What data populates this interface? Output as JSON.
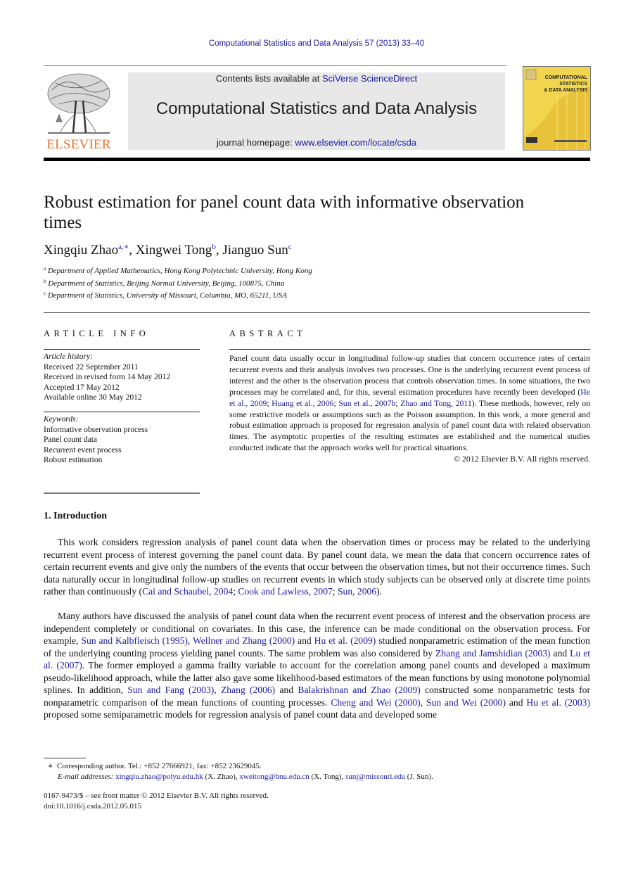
{
  "running_head": "Computational Statistics and Data Analysis 57 (2013) 33–40",
  "masthead": {
    "publisher": "ELSEVIER",
    "contents_prefix": "Contents lists available at ",
    "contents_link": "SciVerse ScienceDirect",
    "journal_title": "Computational Statistics and Data Analysis",
    "homepage_prefix": "journal homepage: ",
    "homepage_link": "www.elsevier.com/locate/csda",
    "cover_lines": [
      "COMPUTATIONAL",
      "STATISTICS",
      "& DATA ANALYSIS"
    ],
    "colors": {
      "publisher_orange": "#e8732c",
      "cover_yellow": "#f2d54e",
      "link_blue": "#1a1aa6"
    }
  },
  "article": {
    "title": "Robust estimation for panel count data with informative observation times",
    "authors": [
      {
        "name": "Xingqiu Zhao",
        "marks": "a,∗",
        "sep": ", "
      },
      {
        "name": "Xingwei Tong",
        "marks": "b",
        "sep": ", "
      },
      {
        "name": "Jianguo Sun",
        "marks": "c",
        "sep": ""
      }
    ],
    "affiliations": [
      {
        "mark": "a",
        "text": "Department of Applied Mathematics, Hong Kong Polytechnic University, Hong Kong"
      },
      {
        "mark": "b",
        "text": "Department of Statistics, Beijing Normal University, Beijing, 100875, China"
      },
      {
        "mark": "c",
        "text": "Department of Statistics, University of Missouri, Columbia, MO, 65211, USA"
      }
    ]
  },
  "article_info": {
    "heading": "ARTICLE INFO",
    "history_label": "Article history:",
    "history": [
      "Received 22 September 2011",
      "Received in revised form 14 May 2012",
      "Accepted 17 May 2012",
      "Available online 30 May 2012"
    ],
    "keywords_label": "Keywords:",
    "keywords": [
      "Informative observation process",
      "Panel count data",
      "Recurrent event process",
      "Robust estimation"
    ]
  },
  "abstract": {
    "heading": "ABSTRACT",
    "text_1": "Panel count data usually occur in longitudinal follow-up studies that concern occurrence rates of certain recurrent events and their analysis involves two processes. One is the underlying recurrent event process of interest and the other is the observation process that controls observation times. In some situations, the two processes may be correlated and, for this, several estimation procedures have recently been developed (",
    "cite_1": "He et al., 2009",
    "cite_2": "Huang et al., 2006",
    "cite_3": "Sun et al., 2007b",
    "cite_4": "Zhao and Tong, 2011",
    "text_2": "). These methods, however, rely on some restrictive models or assumptions such as the Poisson assumption. In this work, a more general and robust estimation approach is proposed for regression analysis of panel count data with related observation times. The asymptotic properties of the resulting estimates are established and the numerical studies conducted indicate that the approach works well for practical situations.",
    "copyright": "© 2012 Elsevier B.V. All rights reserved."
  },
  "introduction": {
    "heading": "1.  Introduction",
    "p1": {
      "text": "This work considers regression analysis of panel count data when the observation times or process may be related to the underlying recurrent event process of interest governing the panel count data. By panel count data, we mean the data that concern occurrence rates of certain recurrent events and give only the numbers of the events that occur between the observation times, but not their occurrence times. Such data naturally occur in longitudinal follow-up studies on recurrent events in which study subjects can be observed only at discrete time points rather than continuously (",
      "c1": "Cai and Schaubel, 2004",
      "c2": "Cook and Lawless, 2007",
      "c3": "Sun, 2006",
      "end": ")."
    },
    "p2": {
      "t0": "Many authors have discussed the analysis of panel count data when the recurrent event process of interest and the observation process are independent completely or conditional on covariates. In this case, the inference can be made conditional on the observation process. For example, ",
      "c1": "Sun and Kalbfleisch (1995)",
      "t1": ", ",
      "c2": "Wellner and Zhang (2000)",
      "t2": " and ",
      "c3": "Hu et al. (2009)",
      "t3": " studied nonparametric estimation of the mean function of the underlying counting process yielding panel counts. The same problem was also considered by ",
      "c4": "Zhang and Jamshidian (2003)",
      "t4": " and ",
      "c5": "Lu et al. (2007)",
      "t5": ". The former employed a gamma frailty variable to account for the correlation among panel counts and developed a maximum pseudo-likelihood approach, while the latter also gave some likelihood-based estimators of the mean functions by using monotone polynomial splines. In addition, ",
      "c6": "Sun and Fang (2003)",
      "t6": ", ",
      "c7": "Zhang (2006)",
      "t7": " and ",
      "c8": "Balakrishnan and Zhao (2009)",
      "t8": " constructed some nonparametric tests for nonparametric comparison of the mean functions of counting processes. ",
      "c9": "Cheng and Wei (2000)",
      "t9": ", ",
      "c10": "Sun and Wei (2000)",
      "t10": " and ",
      "c11": "Hu et al. (2003)",
      "t11": " proposed some semiparametric models for regression analysis of panel count data and developed some"
    }
  },
  "footnotes": {
    "star": "∗",
    "corresponding": "Corresponding author. Tel.: +852 27666921; fax: +852 23629045.",
    "email_label": "E-mail addresses:",
    "emails": [
      {
        "addr": "xingqiu.zhao@polyu.edu.hk",
        "who": " (X. Zhao), "
      },
      {
        "addr": "xweitong@bnu.edu.cn",
        "who": " (X. Tong), "
      },
      {
        "addr": "sunj@missouri.edu",
        "who": " (J. Sun)."
      }
    ],
    "front_matter": "0167-9473/$ – see front matter © 2012 Elsevier B.V. All rights reserved.",
    "doi": "doi:10.1016/j.csda.2012.05.015"
  }
}
